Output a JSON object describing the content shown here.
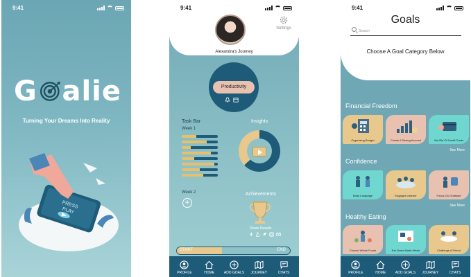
{
  "status": {
    "time": "9:41"
  },
  "splash": {
    "logo_text_left": "G",
    "logo_text_right": "alie",
    "tagline": "Turning Your Dreams Into Reality",
    "phone_screen_text_1": "PRESS",
    "phone_screen_text_2": "PLAY"
  },
  "journey": {
    "user_name": "Alexandra's Journey",
    "settings_label": "Settings",
    "focus_pill": "Productivity",
    "task_bar_title": "Task Bar",
    "week1_label": "Week 1",
    "week2_label": "Week 2",
    "insights_title": "Insights",
    "insights_filled_fraction": 0.63,
    "achievements_title": "Achievements",
    "share_results_label": "Share Results",
    "progress": {
      "start_label": "START",
      "end_label": "END",
      "value": 0.4
    },
    "task_bars": [
      0.4,
      0.7,
      0.25,
      0.8,
      0.35,
      0.9,
      0.5,
      0.6
    ]
  },
  "goals": {
    "title": "Goals",
    "search_placeholder": "Search",
    "subtitle": "Choose A Goal Category Below",
    "see_more": "See More",
    "categories": [
      {
        "name": "Financial Freedom",
        "cards": [
          {
            "label": "Organizing Budget",
            "color": "#e8c88c"
          },
          {
            "label": "Create A Saving Account",
            "color": "#e9c1b0"
          },
          {
            "label": "Get Rid Of Credit Cards",
            "color": "#6fd6d0"
          }
        ]
      },
      {
        "name": "Confidence",
        "cards": [
          {
            "label": "Body Language",
            "color": "#6fd6d0"
          },
          {
            "label": "Engaged Listener",
            "color": "#e8c88c"
          },
          {
            "label": "Focus On Gratitude",
            "color": "#e9c1b0"
          }
        ]
      },
      {
        "name": "Healthy Eating",
        "cards": [
          {
            "label": "Choose Whole Foods",
            "color": "#e9c1b0"
          },
          {
            "label": "Eat Home Made Meals",
            "color": "#6fd6d0"
          },
          {
            "label": "Challenge A Friend",
            "color": "#e8c88c"
          }
        ]
      }
    ]
  },
  "nav": {
    "items": [
      {
        "label": "PROFILE",
        "icon": "profile-icon"
      },
      {
        "label": "HOME",
        "icon": "home-icon"
      },
      {
        "label": "ADD GOALS",
        "icon": "add-goals-icon"
      },
      {
        "label": "JOURNEY",
        "icon": "map-icon"
      },
      {
        "label": "CHATS",
        "icon": "chat-icon"
      }
    ]
  },
  "colors": {
    "teal_dark": "#1e5b78",
    "peach": "#e9c1b0",
    "gold": "#e8c88c",
    "mint": "#6fd6d0"
  }
}
